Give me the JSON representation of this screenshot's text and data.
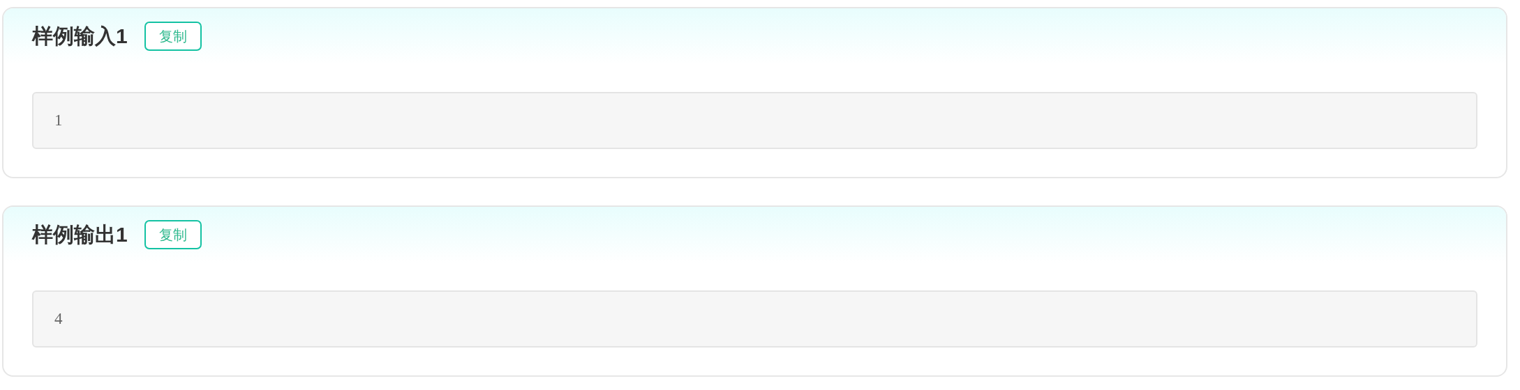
{
  "samples": [
    {
      "title": "样例输入1",
      "copy_button": "复制",
      "content": "1"
    },
    {
      "title": "样例输出1",
      "copy_button": "复制",
      "content": "4"
    }
  ]
}
